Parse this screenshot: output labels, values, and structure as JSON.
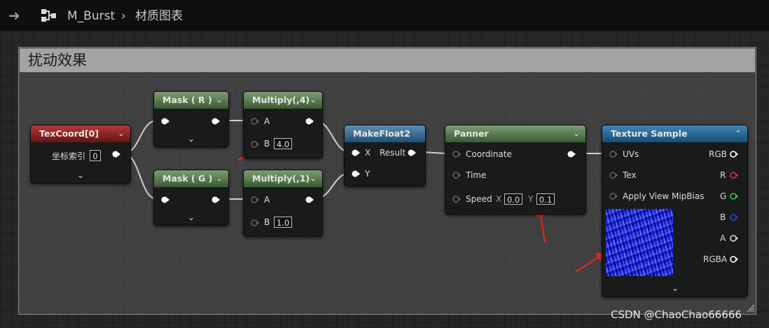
{
  "breadcrumb": {
    "asset": "M_Burst",
    "separator": "›",
    "graph": "材质图表"
  },
  "comment": {
    "title": "扰动效果"
  },
  "nodes": {
    "texcoord": {
      "title": "TexCoord[0]",
      "param_label": "坐标索引",
      "param_value": "0"
    },
    "mask_r": {
      "title": "Mask ( R )"
    },
    "mask_g": {
      "title": "Mask ( G )"
    },
    "multiply1": {
      "title": "Multiply(,4)",
      "a": "A",
      "b": "B",
      "b_value": "4.0"
    },
    "multiply2": {
      "title": "Multiply(,1)",
      "a": "A",
      "b": "B",
      "b_value": "1.0"
    },
    "makefloat2": {
      "title": "MakeFloat2",
      "x": "X",
      "y": "Y",
      "result": "Result"
    },
    "panner": {
      "title": "Panner",
      "coordinate": "Coordinate",
      "time": "Time",
      "speed": "Speed",
      "x_label": "X",
      "x_value": "0.0",
      "y_label": "Y",
      "y_value": "0.1"
    },
    "texture_sample": {
      "title": "Texture Sample",
      "uvs": "UVs",
      "tex": "Tex",
      "apply_view_mipbias": "Apply View MipBias",
      "rgb": "RGB",
      "r": "R",
      "g": "G",
      "b": "B",
      "a": "A",
      "rgba": "RGBA"
    }
  },
  "colors": {
    "pin_red": "#e03030",
    "pin_green": "#30d030",
    "pin_blue": "#3040e0",
    "pin_white": "#ffffff",
    "annotation_arrow": "#e8281e"
  },
  "watermark": "CSDN @ChaoChao66666"
}
